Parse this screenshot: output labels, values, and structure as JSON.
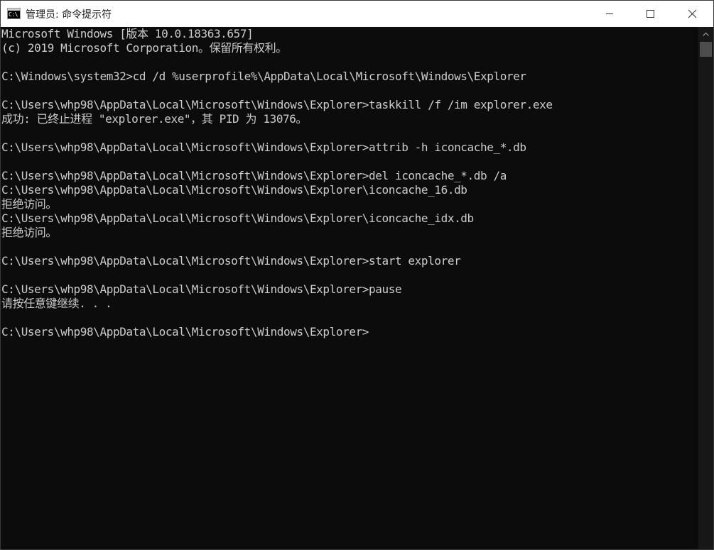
{
  "window": {
    "title": "管理员: 命令提示符",
    "icon_text": "C:\\"
  },
  "console": {
    "lines": [
      "Microsoft Windows [版本 10.0.18363.657]",
      "(c) 2019 Microsoft Corporation。保留所有权利。",
      "",
      "C:\\Windows\\system32>cd /d %userprofile%\\AppData\\Local\\Microsoft\\Windows\\Explorer",
      "",
      "C:\\Users\\whp98\\AppData\\Local\\Microsoft\\Windows\\Explorer>taskkill /f /im explorer.exe",
      "成功: 已终止进程 \"explorer.exe\"，其 PID 为 13076。",
      "",
      "C:\\Users\\whp98\\AppData\\Local\\Microsoft\\Windows\\Explorer>attrib -h iconcache_*.db",
      "",
      "C:\\Users\\whp98\\AppData\\Local\\Microsoft\\Windows\\Explorer>del iconcache_*.db /a",
      "C:\\Users\\whp98\\AppData\\Local\\Microsoft\\Windows\\Explorer\\iconcache_16.db",
      "拒绝访问。",
      "C:\\Users\\whp98\\AppData\\Local\\Microsoft\\Windows\\Explorer\\iconcache_idx.db",
      "拒绝访问。",
      "",
      "C:\\Users\\whp98\\AppData\\Local\\Microsoft\\Windows\\Explorer>start explorer",
      "",
      "C:\\Users\\whp98\\AppData\\Local\\Microsoft\\Windows\\Explorer>pause",
      "请按任意键继续. . .",
      "",
      "C:\\Users\\whp98\\AppData\\Local\\Microsoft\\Windows\\Explorer>"
    ]
  },
  "icons": {
    "app": "cmd-icon",
    "minimize": "minimize-icon",
    "maximize": "maximize-icon",
    "close": "close-icon",
    "scroll_up": "arrow-up-icon"
  },
  "colors": {
    "console_bg": "#0c0c0c",
    "console_text": "#cccccc",
    "titlebar_bg": "#ffffff"
  }
}
